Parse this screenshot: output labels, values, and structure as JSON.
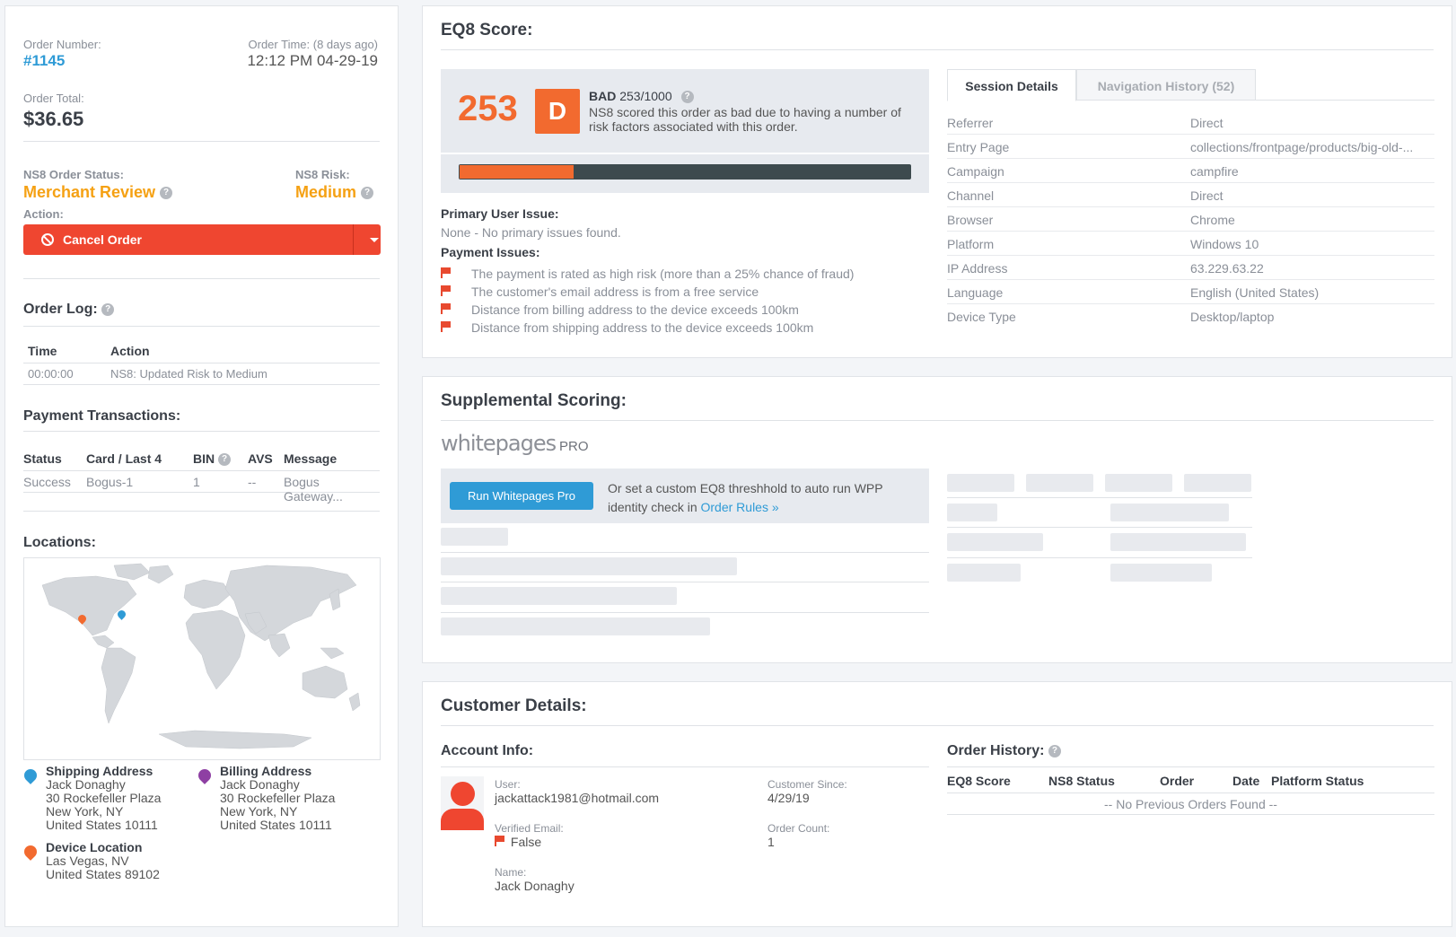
{
  "order": {
    "number_label": "Order Number:",
    "number": "#1145",
    "time_label": "Order Time: (8 days ago)",
    "time": "12:12 PM 04-29-19",
    "total_label": "Order Total:",
    "total": "$36.65",
    "status_label": "NS8 Order Status:",
    "status": "Merchant Review",
    "risk_label": "NS8 Risk:",
    "risk": "Medium",
    "action_label": "Action:",
    "cancel_label": "Cancel Order"
  },
  "order_log": {
    "title": "Order Log:",
    "headers": [
      "Time",
      "Action"
    ],
    "rows": [
      [
        "00:00:00",
        "NS8: Updated Risk to Medium"
      ]
    ]
  },
  "payments": {
    "title": "Payment Transactions:",
    "headers": [
      "Status",
      "Card / Last 4",
      "BIN",
      "AVS",
      "Message"
    ],
    "rows": [
      [
        "Success",
        "Bogus-1",
        "1",
        "--",
        "Bogus Gateway..."
      ]
    ]
  },
  "locations": {
    "title": "Locations:",
    "shipping": {
      "title": "Shipping Address",
      "lines": [
        "Jack Donaghy",
        "30 Rockefeller Plaza",
        "New York, NY",
        "United States 10111"
      ]
    },
    "billing": {
      "title": "Billing Address",
      "lines": [
        "Jack Donaghy",
        "30 Rockefeller Plaza",
        "New York, NY",
        "United States 10111"
      ]
    },
    "device": {
      "title": "Device Location",
      "lines": [
        "Las Vegas, NV",
        "United States 89102"
      ]
    }
  },
  "eq8": {
    "title": "EQ8 Score:",
    "score": "253",
    "grade": "D",
    "rating": "BAD",
    "rating_value": "253/1000",
    "description": "NS8 scored this order as bad due to having a number of risk factors associated with this order.",
    "score_fraction": 0.253,
    "primary_label": "Primary User Issue:",
    "primary_value": "None - No primary issues found.",
    "payment_issues_label": "Payment Issues:",
    "payment_issues": [
      "The payment is rated as high risk (more than a 25% chance of fraud)",
      "The customer's email address is from a free service",
      "Distance from billing address to the device exceeds 100km",
      "Distance from shipping address to the device exceeds 100km"
    ],
    "tabs": [
      "Session Details",
      "Navigation History (52)"
    ],
    "session": [
      [
        "Referrer",
        "Direct"
      ],
      [
        "Entry Page",
        "collections/frontpage/products/big-old-..."
      ],
      [
        "Campaign",
        "campfire"
      ],
      [
        "Channel",
        "Direct"
      ],
      [
        "Browser",
        "Chrome"
      ],
      [
        "Platform",
        "Windows 10"
      ],
      [
        "IP Address",
        "63.229.63.22"
      ],
      [
        "Language",
        "English (United States)"
      ],
      [
        "Device Type",
        "Desktop/laptop"
      ]
    ]
  },
  "supplemental": {
    "title": "Supplemental Scoring:",
    "logo_main": "whitepages",
    "logo_sub": "PRO",
    "run_button": "Run Whitepages Pro",
    "hint_text": "Or set a custom EQ8 threshhold to auto run WPP identity check in",
    "hint_link": "Order Rules »"
  },
  "customer": {
    "title": "Customer Details:",
    "account_title": "Account Info:",
    "user_label": "User:",
    "user_value": "jackattack1981@hotmail.com",
    "since_label": "Customer Since:",
    "since_value": "4/29/19",
    "verified_label": "Verified Email:",
    "verified_value": "False",
    "count_label": "Order Count:",
    "count_value": "1",
    "name_label": "Name:",
    "name_value": "Jack Donaghy",
    "history_title": "Order History:",
    "history_headers": [
      "EQ8 Score",
      "NS8 Status",
      "Order",
      "Date",
      "Platform Status"
    ],
    "history_empty": "-- No Previous Orders Found --"
  },
  "colors": {
    "accent": "#2f9bd6",
    "orange": "#f5a114",
    "danger": "#ef4630",
    "score": "#f26a2f"
  }
}
